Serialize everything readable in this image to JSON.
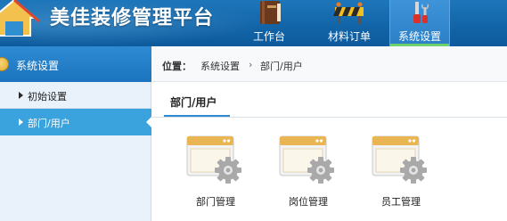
{
  "app": {
    "title": "美佳装修管理平台"
  },
  "nav": {
    "items": [
      {
        "label": "工作台",
        "icon": "book-icon"
      },
      {
        "label": "材料订单",
        "icon": "construction-barrier-icon"
      },
      {
        "label": "系统设置",
        "icon": "tools-icon",
        "active": true
      }
    ]
  },
  "sidebar": {
    "heading": "系统设置",
    "items": [
      {
        "label": "初始设置"
      },
      {
        "label": "部门/用户",
        "active": true
      }
    ]
  },
  "breadcrumb": {
    "prefix": "位置：",
    "items": [
      "系统设置",
      "部门/用户"
    ],
    "separator": "›"
  },
  "main": {
    "tab": "部门/用户",
    "tiles": [
      {
        "label": "部门管理",
        "icon": "window-gear-icon"
      },
      {
        "label": "岗位管理",
        "icon": "window-gear-icon"
      },
      {
        "label": "员工管理",
        "icon": "window-gear-icon"
      }
    ]
  },
  "colors": {
    "header": "#1265a8",
    "accent": "#3aa2dc",
    "active_bar": "#6ed06e"
  }
}
